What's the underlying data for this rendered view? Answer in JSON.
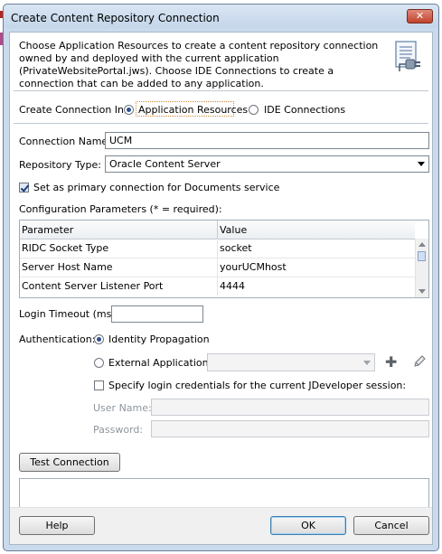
{
  "window": {
    "title": "Create Content Repository Connection",
    "close_glyph": "✕"
  },
  "info": {
    "text": "Choose Application Resources to create a content repository connection owned by and deployed with the current application (PrivateWebsitePortal.jws). Choose IDE Connections to create a connection that can be added to any application.",
    "icon": "connection-document-icon"
  },
  "create_in": {
    "label": "Create Connection In:",
    "options": [
      {
        "label": "Application Resources",
        "selected": true
      },
      {
        "label": "IDE Connections",
        "selected": false
      }
    ]
  },
  "connection_name": {
    "label": "Connection Name:",
    "value": "UCM"
  },
  "repository_type": {
    "label": "Repository Type:",
    "value": "Oracle Content Server"
  },
  "primary_checkbox": {
    "label": "Set as primary connection for Documents service",
    "checked": true
  },
  "config": {
    "label": "Configuration Parameters (* = required):",
    "columns": [
      "Parameter",
      "Value"
    ],
    "rows": [
      {
        "parameter": "RIDC Socket Type",
        "value": "socket"
      },
      {
        "parameter": "Server Host Name",
        "value": "yourUCMhost"
      },
      {
        "parameter": "Content Server Listener Port",
        "value": "4444"
      }
    ]
  },
  "login_timeout": {
    "label": "Login Timeout (ms):",
    "value": ""
  },
  "authentication": {
    "label": "Authentication:",
    "identity_propagation": {
      "label": "Identity Propagation",
      "selected": true
    },
    "external_application": {
      "label": "External Application:",
      "selected": false,
      "value": ""
    },
    "add_icon": "plus-icon",
    "edit_icon": "pencil-icon"
  },
  "login_credentials": {
    "label": "Specify login credentials for the current JDeveloper session:",
    "checked": false,
    "user_name_label": "User Name:",
    "user_name_value": "",
    "password_label": "Password:",
    "password_value": ""
  },
  "test_connection": {
    "label": "Test Connection",
    "status": ""
  },
  "footer": {
    "help": "Help",
    "ok": "OK",
    "cancel": "Cancel"
  },
  "colors": {
    "window_frame": "#c9daec",
    "close_button": "#c0432d",
    "selection_focus": "#d08a3a"
  }
}
